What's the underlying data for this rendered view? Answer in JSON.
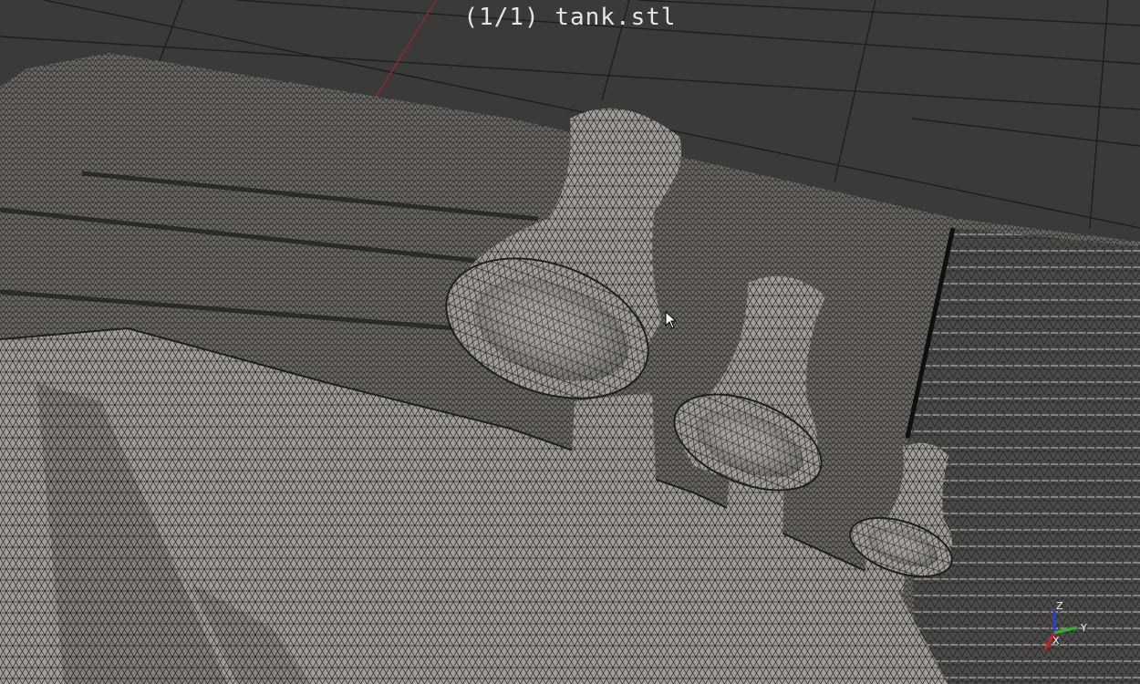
{
  "viewer": {
    "title": "(1/1) tank.stl",
    "model": "tank.stl",
    "file_index": "1/1"
  },
  "axes": {
    "z_label": "Z",
    "y_label": "Y",
    "x_label": "X"
  },
  "colors": {
    "background": "#3a3a3a",
    "grid": "#1c1c1c",
    "mesh_fill": "#9a9690",
    "mesh_edge": "#2a2a2a",
    "x_axis": "#d22020",
    "y_axis": "#2bb52b",
    "z_axis": "#2a3fd0",
    "x_grid_line": "#8a2a2a"
  }
}
